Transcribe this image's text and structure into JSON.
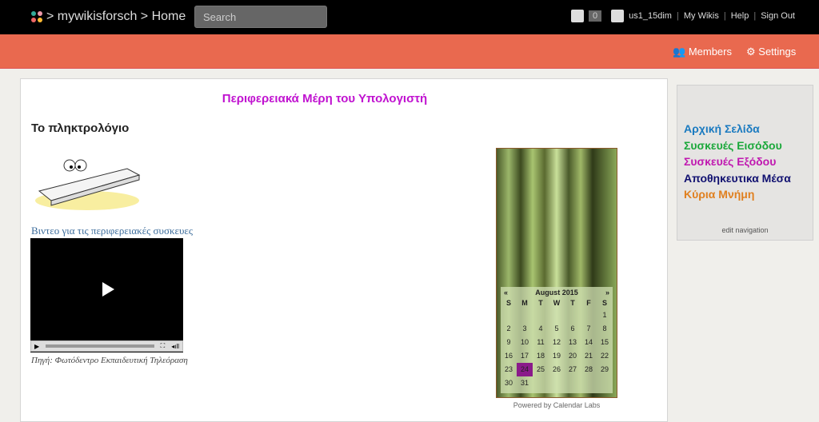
{
  "topbar": {
    "wiki": "mywikisforsch",
    "page": "Home",
    "search_placeholder": "Search",
    "notif_count": "0",
    "user": "us1_15dim",
    "links": [
      "My Wikis",
      "Help",
      "Sign Out"
    ]
  },
  "subbar": {
    "members": "Members",
    "settings": "Settings"
  },
  "main": {
    "title": "Περιφερειακά Μέρη του Υπολογιστή",
    "subtitle": "Το πληκτρολόγιο",
    "video_link": "Βιντεο για τις περιφερειακές συσκευες",
    "source": "Πηγή: Φωτόδεντρο Εκπαιδευτική Τηλεόραση"
  },
  "calendar": {
    "prev": "«",
    "next": "»",
    "month": "August 2015",
    "days": [
      "S",
      "M",
      "T",
      "W",
      "T",
      "F",
      "S"
    ],
    "weeks": [
      [
        "",
        "",
        "",
        "",
        "",
        "",
        "1"
      ],
      [
        "2",
        "3",
        "4",
        "5",
        "6",
        "7",
        "8"
      ],
      [
        "9",
        "10",
        "11",
        "12",
        "13",
        "14",
        "15"
      ],
      [
        "16",
        "17",
        "18",
        "19",
        "20",
        "21",
        "22"
      ],
      [
        "23",
        "24",
        "25",
        "26",
        "27",
        "28",
        "29"
      ],
      [
        "30",
        "31",
        "",
        "",
        "",
        "",
        ""
      ]
    ],
    "highlighted": "24",
    "highlight_color": "#8a1a8a",
    "powered": "Powered by Calendar Labs"
  },
  "sidebar": {
    "items": [
      {
        "label": "Αρχική Σελίδα",
        "color": "#1a7ac0"
      },
      {
        "label": "Συσκευές Εισόδου",
        "color": "#1aa83a"
      },
      {
        "label": "Συσκευές Εξόδου",
        "color": "#c018b0"
      },
      {
        "label": "Αποθηκευτικα Μέσα",
        "color": "#101070"
      },
      {
        "label": "Κύρια Μνήμη",
        "color": "#e08020"
      }
    ],
    "edit": "edit navigation"
  }
}
